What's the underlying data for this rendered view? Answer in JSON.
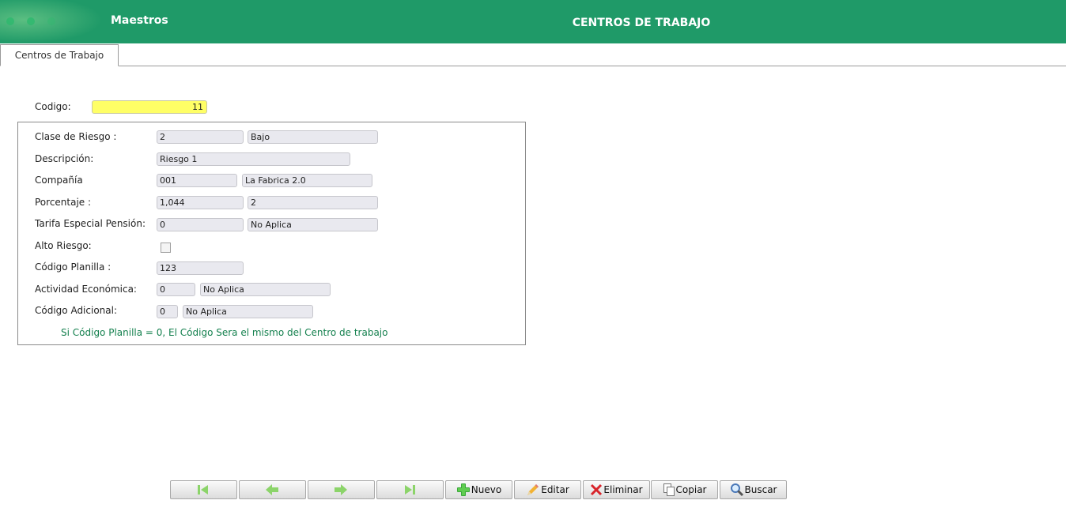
{
  "header": {
    "app_title": "Maestros",
    "page_title": "CENTROS DE TRABAJO"
  },
  "tabs": [
    {
      "label": "Centros de Trabajo"
    }
  ],
  "codigo": {
    "label": "Codigo:",
    "value": "11"
  },
  "form": {
    "clase_riesgo": {
      "label": "Clase de Riesgo :",
      "code": "2",
      "name": "Bajo"
    },
    "descripcion": {
      "label": "Descripción:",
      "value": "Riesgo 1"
    },
    "compania": {
      "label": "Compañía",
      "code": "001",
      "name": "La Fabrica 2.0"
    },
    "porcentaje": {
      "label": "Porcentaje :",
      "value": "1,044",
      "extra": "2"
    },
    "tarifa": {
      "label": "Tarifa Especial Pensión:",
      "code": "0",
      "name": "No Aplica"
    },
    "alto_riesgo": {
      "label": "Alto Riesgo:",
      "checked": false
    },
    "codigo_planilla": {
      "label": "Código Planilla :",
      "value": "123"
    },
    "actividad": {
      "label": "Actividad Económica:",
      "code": "0",
      "name": "No Aplica"
    },
    "codigo_adicional": {
      "label": "Código Adicional:",
      "code": "0",
      "name": "No Aplica"
    },
    "note": "Si Código Planilla = 0, El Código Sera el mismo del Centro de trabajo"
  },
  "toolbar": {
    "first_icon": "first-icon",
    "prev_icon": "arrow-left-icon",
    "next_icon": "arrow-right-icon",
    "last_icon": "last-icon",
    "new_label": "Nuevo",
    "edit_label": "Editar",
    "delete_label": "Eliminar",
    "copy_label": "Copiar",
    "search_label": "Buscar"
  },
  "colors": {
    "header": "#1f9a68",
    "codigo_bg": "#ffff66",
    "note": "#14804e",
    "nav_green": "#8cd46a"
  }
}
